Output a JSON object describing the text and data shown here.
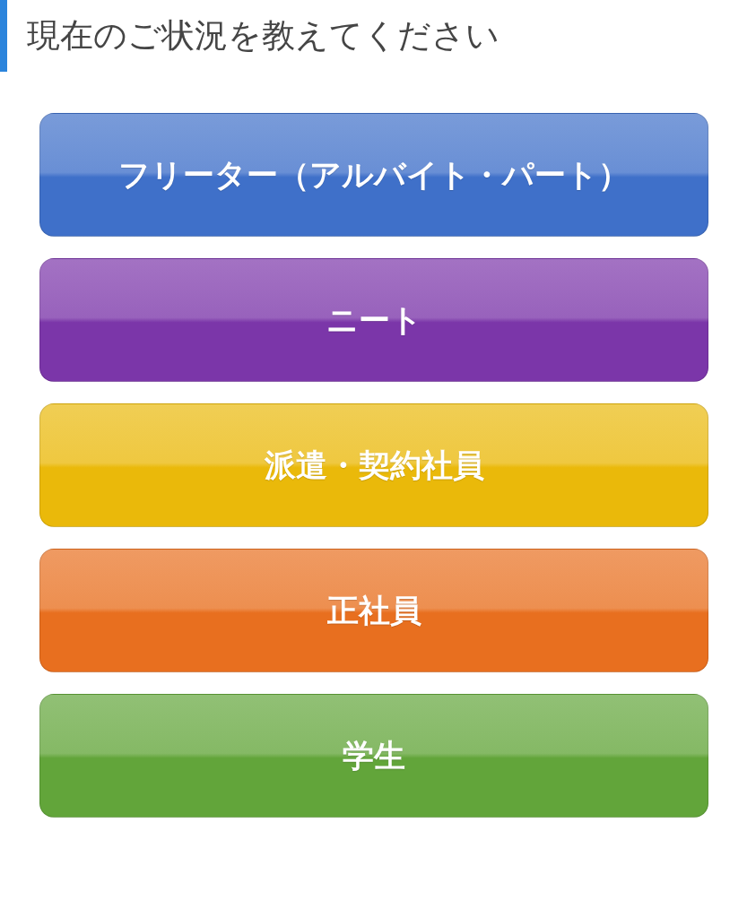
{
  "heading": "現在のご状況を教えてください",
  "options": [
    {
      "label": "フリーター（アルバイト・パート）",
      "color": "#3f70c9"
    },
    {
      "label": "ニート",
      "color": "#7b36a9"
    },
    {
      "label": "派遣・契約社員",
      "color": "#eab90a"
    },
    {
      "label": "正社員",
      "color": "#e86f1f"
    },
    {
      "label": "学生",
      "color": "#62a53a"
    }
  ]
}
